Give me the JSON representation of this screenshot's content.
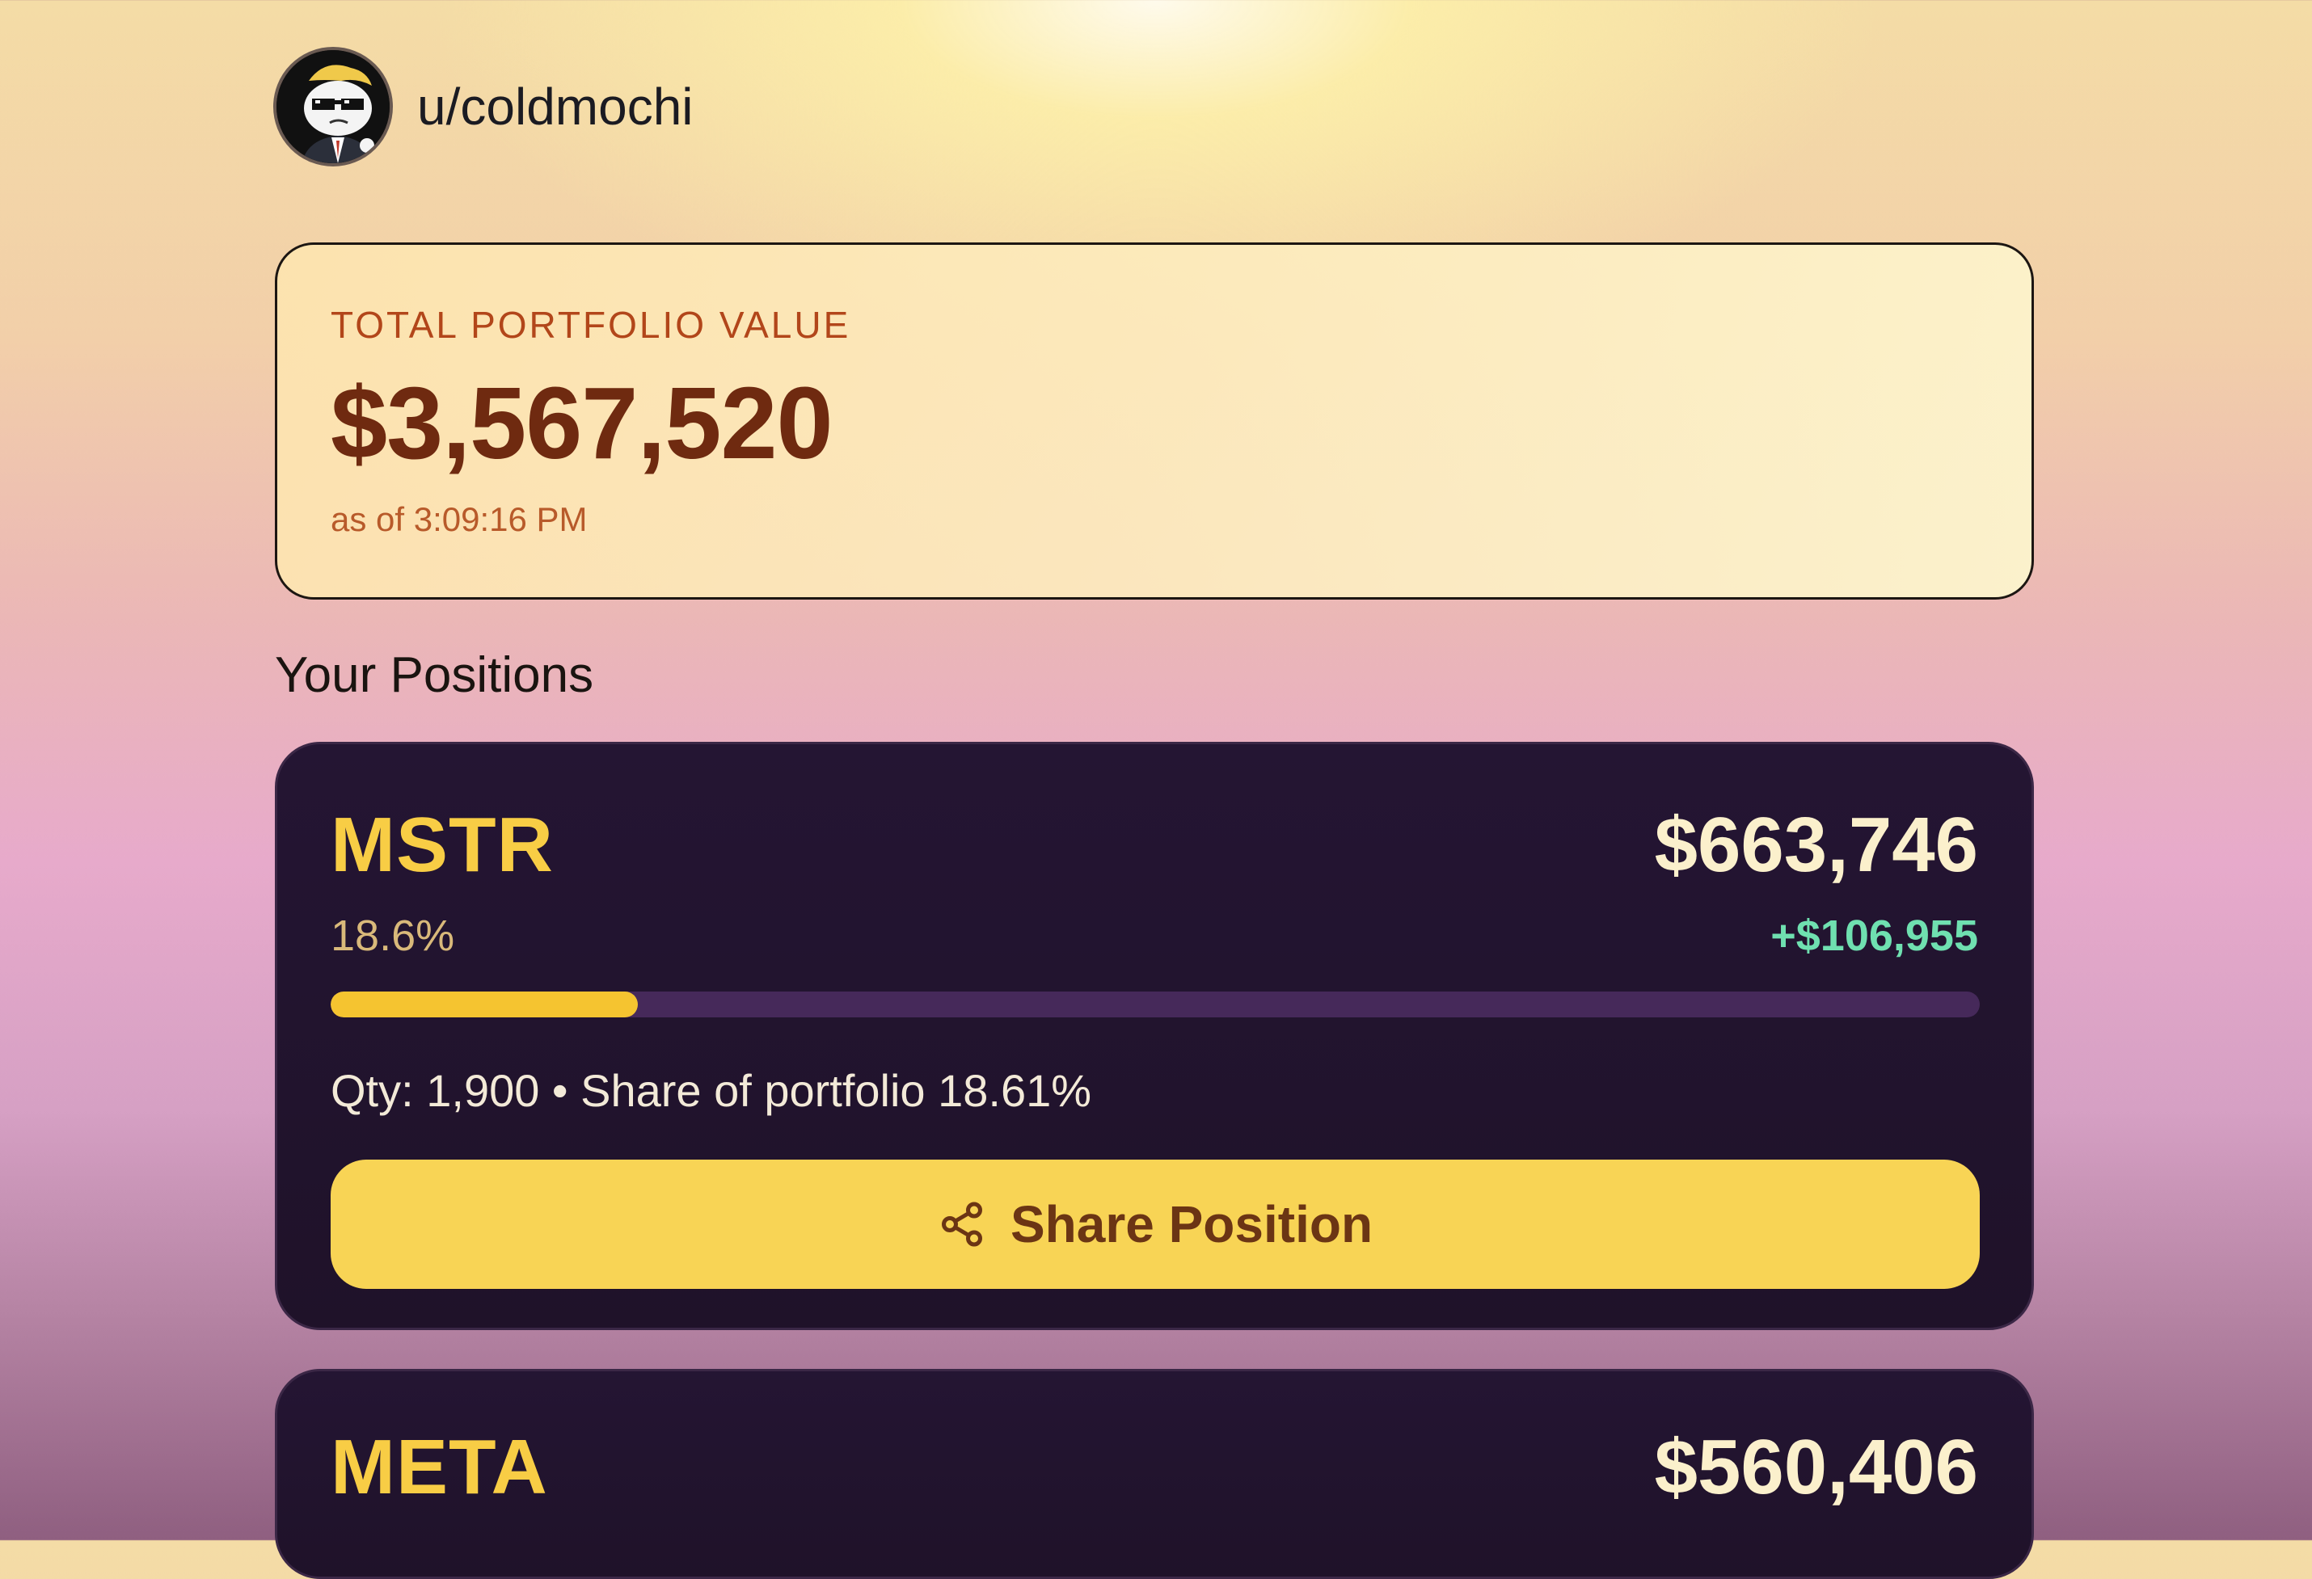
{
  "user": {
    "username": "u/coldmochi",
    "avatar_icon": "wsb-mascot-avatar"
  },
  "portfolio": {
    "label": "TOTAL PORTFOLIO VALUE",
    "value": "$3,567,520",
    "as_of": "as of 3:09:16 PM"
  },
  "positions_title": "Your Positions",
  "positions": [
    {
      "ticker": "MSTR",
      "value": "$663,746",
      "percent": "18.6%",
      "gain": "+$106,955",
      "share_fraction": 0.1861,
      "details": "Qty: 1,900 • Share of portfolio 18.61%",
      "share_button": "Share Position"
    },
    {
      "ticker": "META",
      "value": "$560,406"
    }
  ],
  "colors": {
    "accent_yellow": "#f8cd45",
    "card_bg": "#241533",
    "gain_green": "#6fe0b0",
    "total_value": "#6f2a10"
  }
}
